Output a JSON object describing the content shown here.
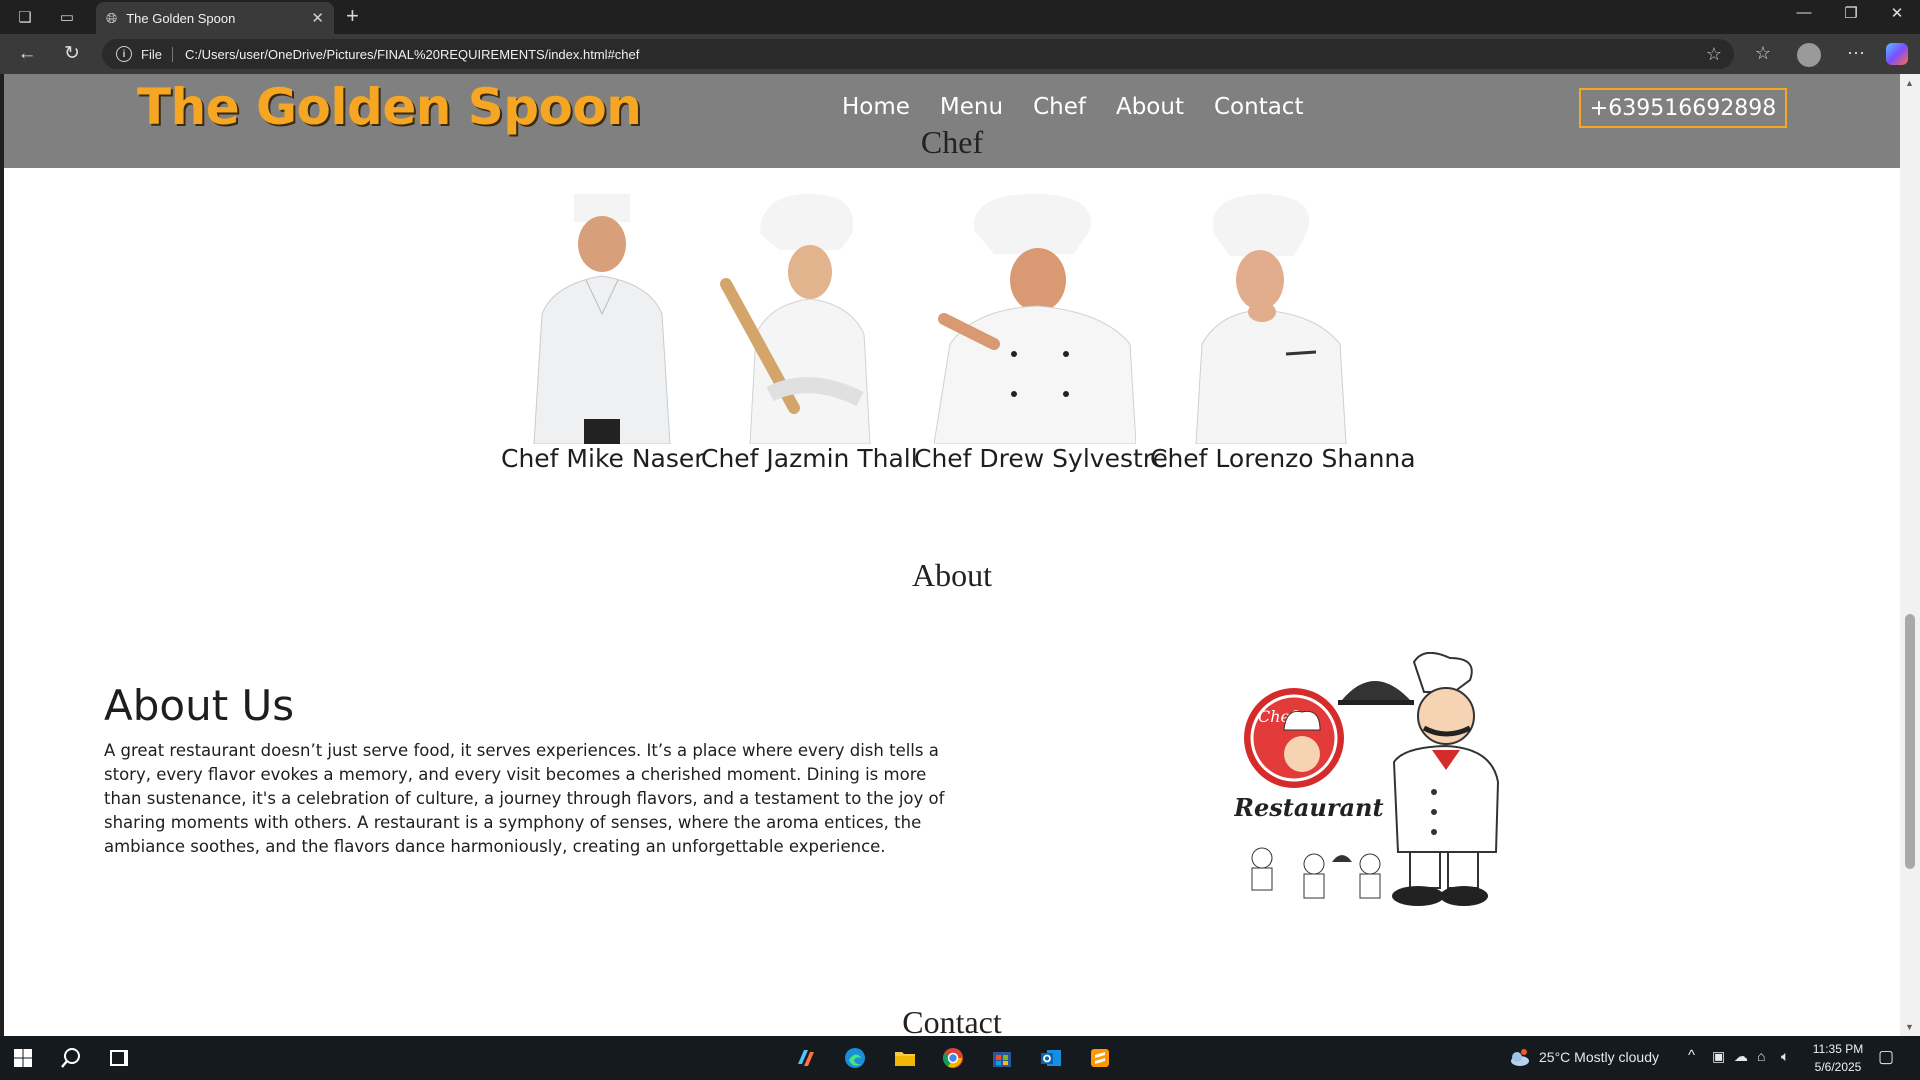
{
  "browser": {
    "tab_title": "The Golden Spoon",
    "scheme_label": "File",
    "url": "C:/Users/user/OneDrive/Pictures/FINAL%20REQUIREMENTS/index.html#chef"
  },
  "site": {
    "brand": "The Golden Spoon",
    "nav": [
      "Home",
      "Menu",
      "Chef",
      "About",
      "Contact"
    ],
    "phone": "+639516692898",
    "chef_heading": "Chef",
    "chefs": [
      {
        "name": "Chef Mike Naser"
      },
      {
        "name": "Chef Jazmin Thall"
      },
      {
        "name": "Chef Drew Sylvestre"
      },
      {
        "name": "Chef Lorenzo Shanna"
      }
    ],
    "about_heading": "About",
    "about_title": "About Us",
    "about_text": "A great restaurant doesn’t just serve food, it serves experiences. It’s a place where every dish tells a story, every flavor evokes a memory, and every visit becomes a cherished moment. Dining is more than sustenance, it's a celebration of culture, a journey through flavors, and a testament to the joy of sharing moments with others. A restaurant is a symphony of senses, where the aroma entices, the ambiance soothes, and the flavors dance harmoniously, creating an unforgettable experience.",
    "logo_text_chef": "Chef",
    "logo_text_restaurant": "Restaurant",
    "contact_heading": "Contact"
  },
  "taskbar": {
    "weather": "25°C  Mostly cloudy",
    "time": "11:35 PM",
    "date": "5/6/2025"
  },
  "colors": {
    "brand": "#f5a623",
    "header_bg": "#808080"
  }
}
